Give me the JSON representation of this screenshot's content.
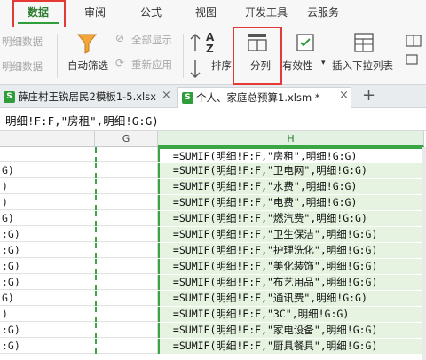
{
  "menu": {
    "tabs": [
      "数据",
      "审阅",
      "公式",
      "视图",
      "开发工具",
      "云服务"
    ]
  },
  "ribbon": {
    "left_cut_1": "明细数据",
    "left_cut_2": "明细数据",
    "auto_filter": "自动筛选",
    "show_all": "全部显示",
    "reapply": "重新应用",
    "sort": "排序",
    "split": "分列",
    "validity": "有效性",
    "insert_dropdown": "插入下拉列表"
  },
  "doc_tabs": [
    {
      "label": "薛庄村王锐居民2模板1-5.xlsx",
      "active": false
    },
    {
      "label": "个人、家庭总预算1.xlsm *",
      "active": true
    }
  ],
  "formula_bar": {
    "text": "明细!F:F,\"房租\",明细!G:G)"
  },
  "columns": {
    "g": "G",
    "h": "H"
  },
  "rows": [
    {
      "a": "",
      "h": "'=SUMIF(明细!F:F,\"房租\",明细!G:G)"
    },
    {
      "a": "G)",
      "h": "'=SUMIF(明细!F:F,\"卫电网\",明细!G:G)"
    },
    {
      "a": ")",
      "h": "'=SUMIF(明细!F:F,\"水费\",明细!G:G)"
    },
    {
      "a": ")",
      "h": "'=SUMIF(明细!F:F,\"电费\",明细!G:G)"
    },
    {
      "a": "G)",
      "h": "'=SUMIF(明细!F:F,\"燃汽费\",明细!G:G)"
    },
    {
      "a": ":G)",
      "h": "'=SUMIF(明细!F:F,\"卫生保洁\",明细!G:G)"
    },
    {
      "a": ":G)",
      "h": "'=SUMIF(明细!F:F,\"护理洗化\",明细!G:G)"
    },
    {
      "a": ":G)",
      "h": "'=SUMIF(明细!F:F,\"美化装饰\",明细!G:G)"
    },
    {
      "a": ":G)",
      "h": "'=SUMIF(明细!F:F,\"布艺用品\",明细!G:G)"
    },
    {
      "a": "G)",
      "h": "'=SUMIF(明细!F:F,\"通讯费\",明细!G:G)"
    },
    {
      "a": ")",
      "h": "'=SUMIF(明细!F:F,\"3C\",明细!G:G)"
    },
    {
      "a": ":G)",
      "h": "'=SUMIF(明细!F:F,\"家电设备\",明细!G:G)"
    },
    {
      "a": ":G)",
      "h": "'=SUMIF(明细!F:F,\"厨具餐具\",明细!G:G)"
    }
  ],
  "colors": {
    "accent": "#2e9d3a",
    "highlight_box": "#e53935",
    "selection_fill": "#e6f3e0"
  }
}
